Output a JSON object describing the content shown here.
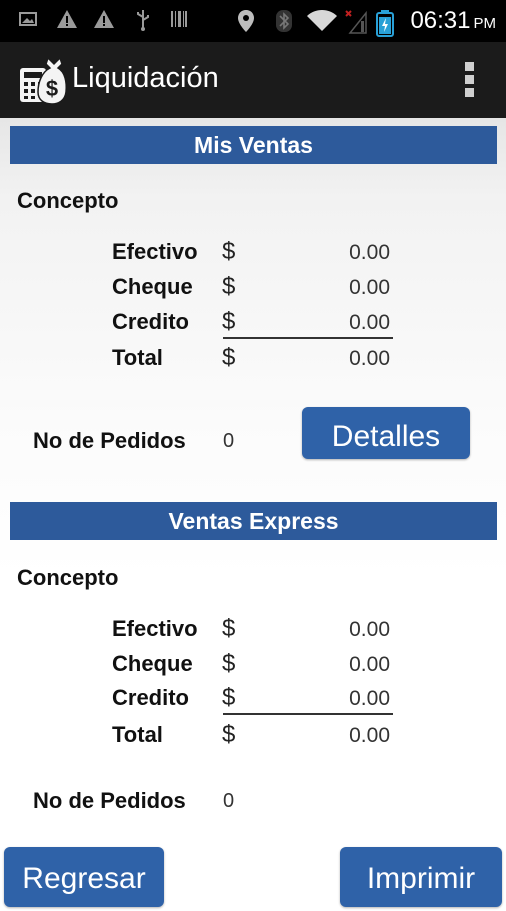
{
  "status_bar": {
    "time": "06:31",
    "ampm": "PM",
    "icons": [
      "image-icon",
      "warning-icon",
      "warning-icon",
      "usb-icon",
      "barcode-icon",
      "location-icon",
      "bluetooth-icon",
      "wifi-icon",
      "no-signal-icon",
      "battery-icon"
    ]
  },
  "action_bar": {
    "title": "Liquidación",
    "app_icon": "calculator-money-bag-icon",
    "menu_icon": "overflow-menu-icon"
  },
  "sections": [
    {
      "header": "Mis Ventas",
      "concept_label": "Concepto",
      "rows": [
        {
          "label": "Efectivo",
          "currency": "$",
          "value": "0.00"
        },
        {
          "label": "Cheque",
          "currency": "$",
          "value": "0.00"
        },
        {
          "label": "Credito",
          "currency": "$",
          "value": "0.00"
        },
        {
          "label": "Total",
          "currency": "$",
          "value": "0.00"
        }
      ],
      "orders_label": "No de Pedidos",
      "orders_value": "0",
      "details_button": "Detalles"
    },
    {
      "header": "Ventas Express",
      "concept_label": "Concepto",
      "rows": [
        {
          "label": "Efectivo",
          "currency": "$",
          "value": "0.00"
        },
        {
          "label": "Cheque",
          "currency": "$",
          "value": "0.00"
        },
        {
          "label": "Credito",
          "currency": "$",
          "value": "0.00"
        },
        {
          "label": "Total",
          "currency": "$",
          "value": "0.00"
        }
      ],
      "orders_label": "No de Pedidos",
      "orders_value": "0"
    }
  ],
  "footer": {
    "back_button": "Regresar",
    "print_button": "Imprimir"
  },
  "colors": {
    "header_blue": "#2d5a9b",
    "button_blue": "#2f62a8",
    "action_bar": "#1b1b1b"
  }
}
